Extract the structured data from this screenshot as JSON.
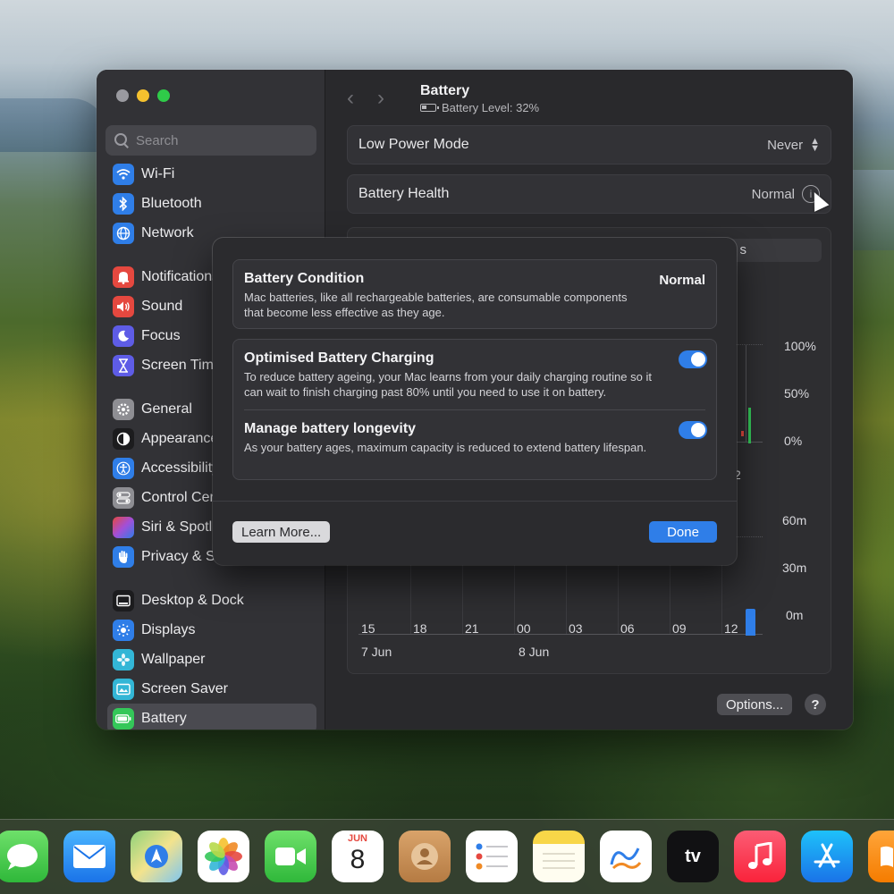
{
  "window": {
    "title": "Battery",
    "subtitle": "Battery Level: 32%"
  },
  "search": {
    "placeholder": "Search"
  },
  "sidebar": {
    "items": [
      {
        "label": "Wi-Fi",
        "icon": "wifi-icon",
        "color": "#2f7ee8"
      },
      {
        "label": "Bluetooth",
        "icon": "bluetooth-icon",
        "color": "#2f7ee8"
      },
      {
        "label": "Network",
        "icon": "globe-icon",
        "color": "#2f7ee8"
      },
      {
        "label": "Notifications",
        "icon": "bell-icon",
        "color": "#e5483f"
      },
      {
        "label": "Sound",
        "icon": "speaker-icon",
        "color": "#e5483f"
      },
      {
        "label": "Focus",
        "icon": "moon-icon",
        "color": "#5e5ce6"
      },
      {
        "label": "Screen Time",
        "icon": "hourglass-icon",
        "color": "#5e5ce6"
      },
      {
        "label": "General",
        "icon": "gear-icon",
        "color": "#8e8e93"
      },
      {
        "label": "Appearance",
        "icon": "appearance-icon",
        "color": "#1c1c1e"
      },
      {
        "label": "Accessibility",
        "icon": "accessibility-icon",
        "color": "#2f7ee8"
      },
      {
        "label": "Control Centre",
        "icon": "toggles-icon",
        "color": "#8e8e93"
      },
      {
        "label": "Siri & Spotlight",
        "icon": "siri-icon",
        "color": "#a34fd8"
      },
      {
        "label": "Privacy & Security",
        "icon": "hand-icon",
        "color": "#2f7ee8"
      },
      {
        "label": "Desktop & Dock",
        "icon": "dock-icon",
        "color": "#1c1c1e"
      },
      {
        "label": "Displays",
        "icon": "sun-icon",
        "color": "#2f7ee8"
      },
      {
        "label": "Wallpaper",
        "icon": "flower-icon",
        "color": "#33b6d6"
      },
      {
        "label": "Screen Saver",
        "icon": "screensaver-icon",
        "color": "#33b6d6"
      },
      {
        "label": "Battery",
        "icon": "battery-icon",
        "color": "#34c759",
        "active": true
      }
    ]
  },
  "rows": {
    "low_power": {
      "label": "Low Power Mode",
      "value": "Never"
    },
    "health": {
      "label": "Battery Health",
      "value": "Normal"
    }
  },
  "chart": {
    "level_ticks": [
      "100%",
      "50%",
      "0%"
    ],
    "usage_ticks": [
      "60m",
      "30m",
      "0m"
    ],
    "x_ticks": [
      "15",
      "18",
      "21",
      "00",
      "03",
      "06",
      "09",
      "12"
    ],
    "date_labels": [
      "7 Jun",
      "8 Jun"
    ],
    "partial_tick": "2",
    "partial_tab": "s"
  },
  "sheet": {
    "condition": {
      "title": "Battery Condition",
      "value": "Normal",
      "desc": "Mac batteries, like all rechargeable batteries, are consumable components that become less effective as they age."
    },
    "optimised": {
      "title": "Optimised Battery Charging",
      "desc": "To reduce battery ageing, your Mac learns from your daily charging routine so it can wait to finish charging past 80% until you need to use it on battery.",
      "on": true
    },
    "longevity": {
      "title": "Manage battery longevity",
      "desc": "As your battery ages, maximum capacity is reduced to extend battery lifespan.",
      "on": true
    },
    "learn_more": "Learn More...",
    "done": "Done"
  },
  "footer": {
    "options": "Options...",
    "help": "?"
  },
  "dock": {
    "calendar_month": "JUN",
    "calendar_day": "8",
    "tv_label": "tv",
    "apps": [
      "Messages",
      "Mail",
      "Maps",
      "Photos",
      "FaceTime",
      "Calendar",
      "Contacts",
      "Reminders",
      "Notes",
      "Freeform",
      "TV",
      "Music",
      "App Store",
      "Books"
    ]
  }
}
